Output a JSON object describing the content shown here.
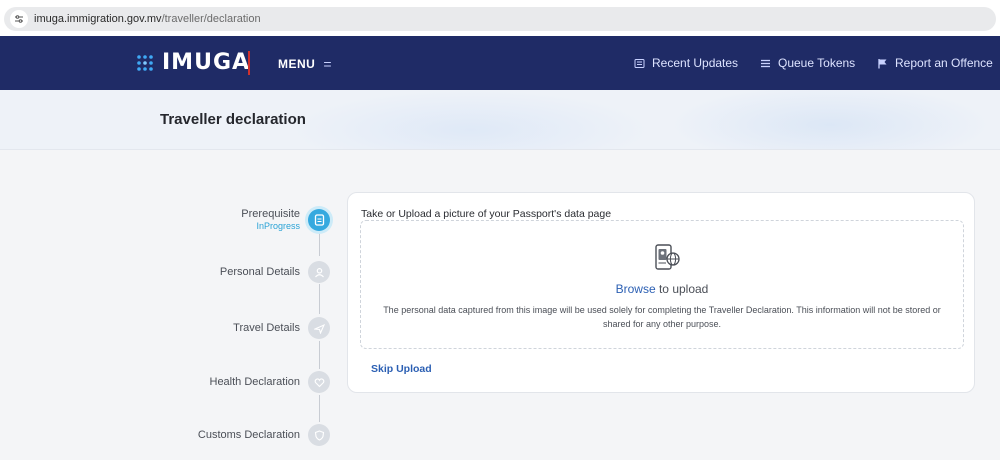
{
  "browser": {
    "url_host": "imuga.immigration.gov.mv",
    "url_path": "/traveller/declaration"
  },
  "nav": {
    "logo_text": "IMUGA",
    "menu_label": "MENU",
    "menu_glyph": "=",
    "links": [
      {
        "label": "Recent Updates",
        "icon": "updates-icon"
      },
      {
        "label": "Queue Tokens",
        "icon": "list-icon"
      },
      {
        "label": "Report an Offence",
        "icon": "flag-icon"
      }
    ]
  },
  "page": {
    "title": "Traveller declaration"
  },
  "steps": [
    {
      "name": "Prerequisite",
      "status": "InProgress",
      "icon": "document-icon",
      "active": true
    },
    {
      "name": "Personal Details",
      "status": "",
      "icon": "person-icon",
      "active": false
    },
    {
      "name": "Travel Details",
      "status": "",
      "icon": "plane-icon",
      "active": false
    },
    {
      "name": "Health Declaration",
      "status": "",
      "icon": "heart-icon",
      "active": false
    },
    {
      "name": "Customs Declaration",
      "status": "",
      "icon": "shield-icon",
      "active": false
    }
  ],
  "upload": {
    "title": "Take or Upload a picture of your Passport's data page",
    "browse_label": "Browse",
    "browse_suffix": " to upload",
    "disclaimer": "The personal data captured from this image will be used solely for completing the Traveller Declaration. This information will not be stored or shared for any other purpose.",
    "skip_label": "Skip Upload",
    "icon": "passport-upload-icon"
  },
  "colors": {
    "nav_bg": "#1f2b66",
    "accent": "#35a9df",
    "link": "#2b5fb3",
    "logo_separator": "#d0312d"
  }
}
